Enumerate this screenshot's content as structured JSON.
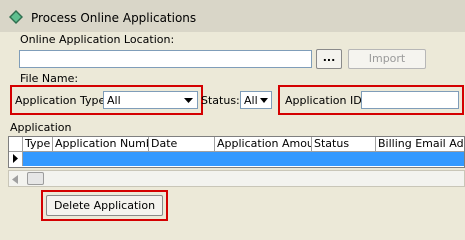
{
  "window": {
    "title": "Process Online Applications"
  },
  "labels": {
    "online_location": "Online Application Location:",
    "file_name": "File Name:",
    "application_type": "Application Type:",
    "status": "Status:",
    "application_id": "Application ID:",
    "application_section": "Application"
  },
  "browse_button": "...",
  "import_button": "Import",
  "application_type_value": "All",
  "status_value": "All",
  "application_id_value": "",
  "location_value": "",
  "grid": {
    "columns": [
      "Type",
      "Application Number",
      "Date",
      "Application Amount",
      "Status",
      "Billing Email Addres"
    ]
  },
  "delete_button": "Delete Application",
  "colors": {
    "highlight": "#d40000",
    "selection": "#3399ff"
  }
}
